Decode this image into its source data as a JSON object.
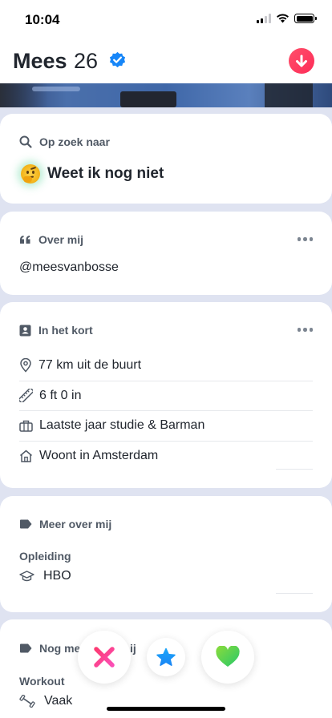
{
  "status_bar": {
    "time": "10:04"
  },
  "profile": {
    "name": "Mees",
    "age": "26",
    "verified_icon": "verified-badge-icon",
    "collapse_icon": "arrow-down-icon"
  },
  "looking_for": {
    "heading": "Op zoek naar",
    "icon": "search-icon",
    "value": "Weet ik nog niet",
    "emoji": "thinking-face-emoji"
  },
  "about": {
    "heading": "Over mij",
    "icon": "quote-icon",
    "text": "@meesvanbosse"
  },
  "basics": {
    "heading": "In het kort",
    "icon": "id-card-icon",
    "items": [
      {
        "icon": "location-pin-icon",
        "label": "77 km uit de buurt"
      },
      {
        "icon": "ruler-icon",
        "label": "6 ft 0 in"
      },
      {
        "icon": "briefcase-icon",
        "label": "Laatste jaar studie & Barman"
      },
      {
        "icon": "home-icon",
        "label": "Woont in Amsterdam"
      }
    ]
  },
  "more_about": {
    "heading": "Meer over mij",
    "icon": "tag-icon",
    "education_label": "Opleiding",
    "education_value": "HBO",
    "education_icon": "graduation-cap-icon"
  },
  "lifestyle": {
    "heading_visible_start": "Nog me",
    "heading_visible_end": "ij",
    "icon": "tag-icon",
    "workout_label": "Workout",
    "workout_value": "Vaak",
    "workout_icon": "dumbbell-icon"
  },
  "actions": {
    "nope_icon": "x-icon",
    "super_like_icon": "star-icon",
    "like_icon": "heart-icon"
  },
  "colors": {
    "accent_red": "#fd2c58",
    "verified_blue": "#1786f8",
    "super_like_blue": "#1a9cf6",
    "like_green": "#3bd16f",
    "nope_pink": "#fc3c8e",
    "page_bg": "#dfe3f1"
  }
}
